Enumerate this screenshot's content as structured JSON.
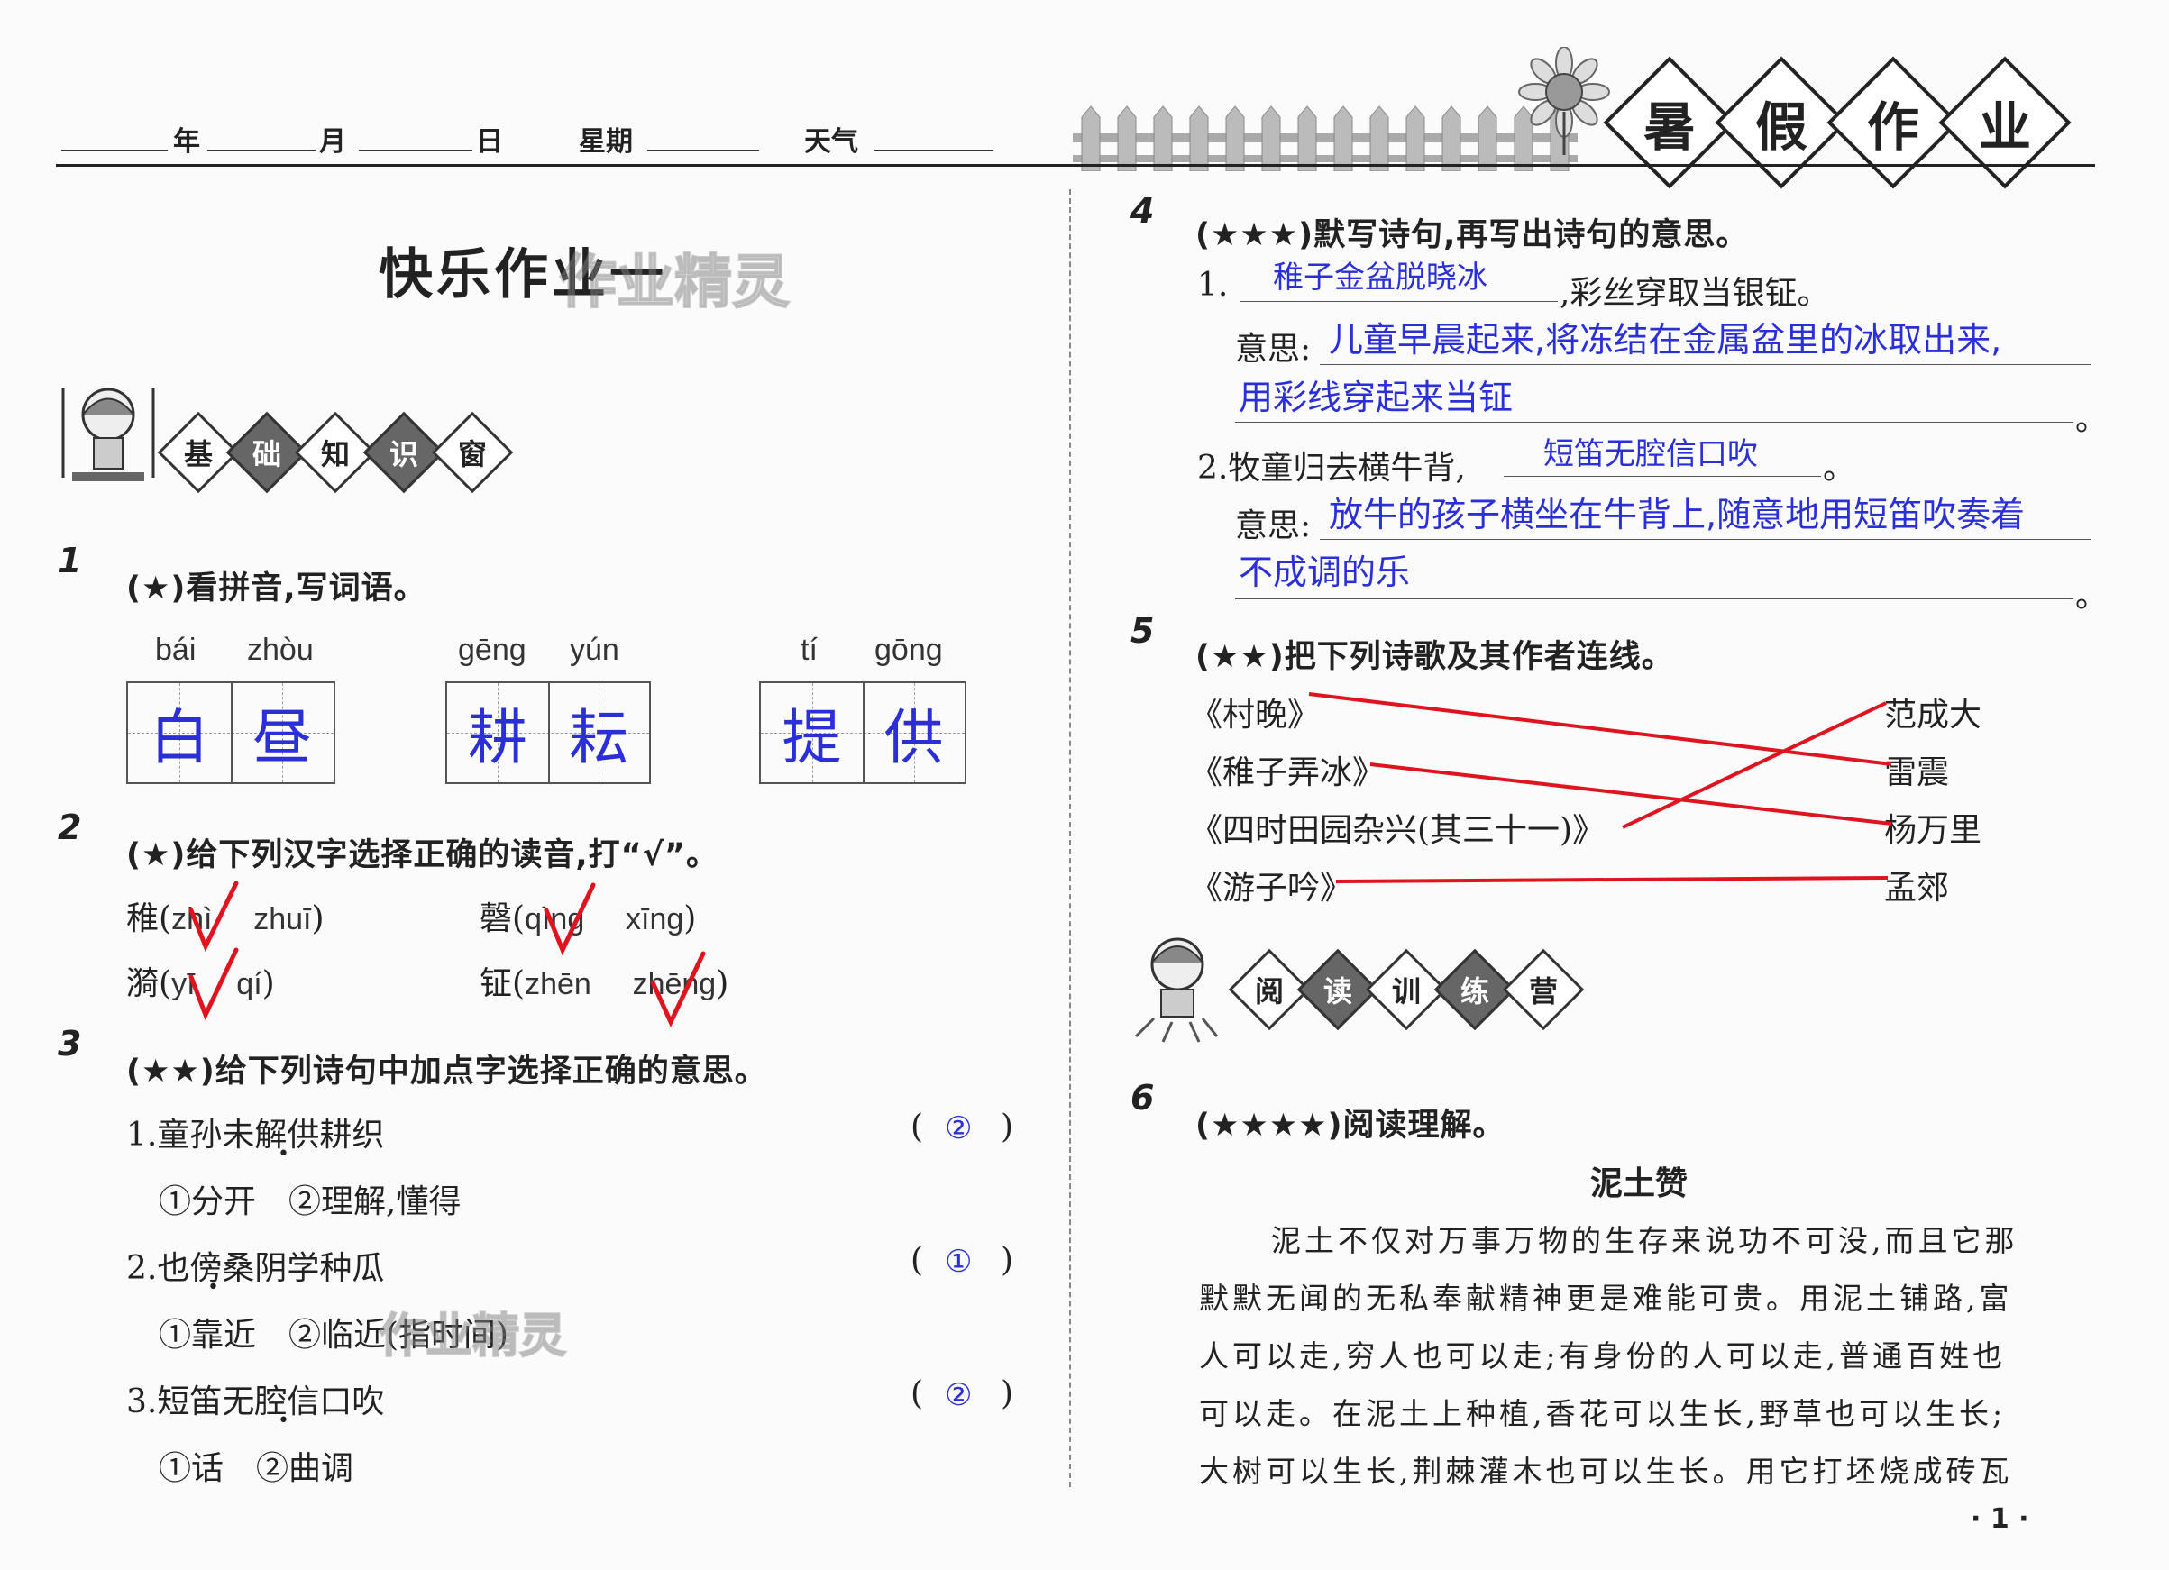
{
  "header": {
    "year": "年",
    "month": "月",
    "day": "日",
    "weekday": "星期",
    "weather": "天气",
    "banner": [
      "暑",
      "假",
      "作",
      "业"
    ]
  },
  "title": "快乐作业一",
  "watermark": "作业精灵",
  "section1": {
    "badges": [
      "基",
      "础",
      "知",
      "识",
      "窗"
    ]
  },
  "q1": {
    "num": "1",
    "text": "(★)看拼音,写词语。",
    "groups": [
      {
        "pinyin": [
          "bái",
          "zhòu"
        ],
        "chars": [
          "白",
          "昼"
        ]
      },
      {
        "pinyin": [
          "gēng",
          "yún"
        ],
        "chars": [
          "耕",
          "耘"
        ]
      },
      {
        "pinyin": [
          "tí",
          "gōng"
        ],
        "chars": [
          "提",
          "供"
        ]
      }
    ]
  },
  "q2": {
    "num": "2",
    "text": "(★)给下列汉字选择正确的读音,打“√”。",
    "items": [
      {
        "char": "稚",
        "open": "(",
        "a": "zhì",
        "b": "zhuī",
        "close": ")"
      },
      {
        "char": "磬",
        "open": "(",
        "a": "qìng",
        "b": "xīng",
        "close": ")"
      },
      {
        "char": "漪",
        "open": "(",
        "a": "yī",
        "b": "qí",
        "close": ")"
      },
      {
        "char": "钲",
        "open": "(",
        "a": "zhēn",
        "b": "zhēng",
        "close": ")"
      }
    ]
  },
  "q3": {
    "num": "3",
    "text": "(★★)给下列诗句中加点字选择正确的意思。",
    "items": [
      {
        "line": "1.童孙未解供耕织",
        "options": "①分开　②理解,懂得",
        "answer": "②"
      },
      {
        "line": "2.也傍桑阴学种瓜",
        "options": "①靠近　②临近(指时间)",
        "answer": "①"
      },
      {
        "line": "3.短笛无腔信口吹",
        "options": "①话　②曲调",
        "answer": "②"
      }
    ],
    "paren_open": "(",
    "paren_close": ")"
  },
  "q4": {
    "num": "4",
    "text": "(★★★)默写诗句,再写出诗句的意思。",
    "item1_prefix": "1.",
    "item1_answer": "稚子金盆脱晓冰",
    "item1_rest": ",彩丝穿取当银钲。",
    "meaning_label": "意思:",
    "item1_meaning_1": "儿童早晨起来,将冻结在金属盆里的冰取出来,",
    "item1_meaning_2": "用彩线穿起来当钲",
    "period": "。",
    "item2_prefix": "2.牧童归去横牛背,",
    "item2_answer": "短笛无腔信口吹",
    "item2_meaning_1": "放牛的孩子横坐在牛背上,随意地用短笛吹奏着",
    "item2_meaning_2": "不成调的乐"
  },
  "q5": {
    "num": "5",
    "text": "(★★)把下列诗歌及其作者连线。",
    "poems": [
      "《村晚》",
      "《稚子弄冰》",
      "《四时田园杂兴(其三十一)》",
      "《游子吟》"
    ],
    "authors": [
      "范成大",
      "雷震",
      "杨万里",
      "孟郊"
    ],
    "links": [
      [
        0,
        1
      ],
      [
        1,
        2
      ],
      [
        2,
        0
      ],
      [
        3,
        3
      ]
    ]
  },
  "section2": {
    "badges": [
      "阅",
      "读",
      "训",
      "练",
      "营"
    ]
  },
  "q6": {
    "num": "6",
    "text": "(★★★★)阅读理解。",
    "passage_title": "泥土赞",
    "lines": [
      "泥土不仅对万事万物的生存来说功不可没,而且它那",
      "默默无闻的无私奉献精神更是难能可贵。用泥土铺路,富",
      "人可以走,穷人也可以走;有身份的人可以走,普通百姓也",
      "可以走。在泥土上种植,香花可以生长,野草也可以生长;",
      "大树可以生长,荆棘灌木也可以生长。用它打坯烧成砖瓦"
    ]
  },
  "page_number": "· 1 ·"
}
